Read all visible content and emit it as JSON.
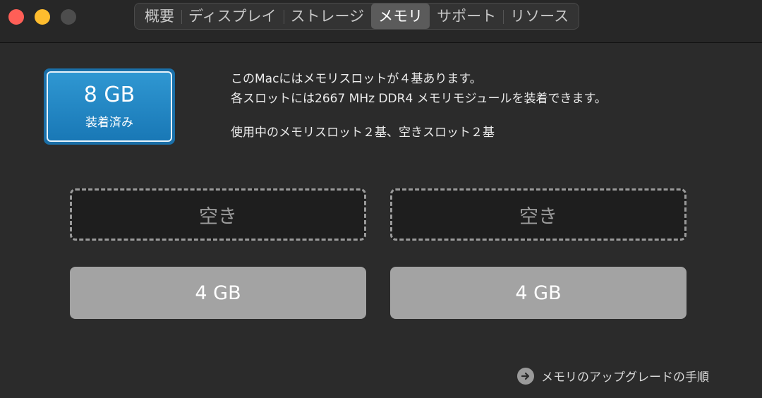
{
  "window": {
    "traffic_lights": [
      "close",
      "minimize",
      "zoom"
    ]
  },
  "tabs": [
    {
      "label": "概要",
      "active": false
    },
    {
      "label": "ディスプレイ",
      "active": false
    },
    {
      "label": "ストレージ",
      "active": false
    },
    {
      "label": "メモリ",
      "active": true
    },
    {
      "label": "サポート",
      "active": false
    },
    {
      "label": "リソース",
      "active": false
    }
  ],
  "installed": {
    "size": "8 GB",
    "label": "装着済み",
    "color": "#1a6fa8"
  },
  "info": {
    "line1": "このMacにはメモリスロットが４基あります。",
    "line2": "各スロットには2667 MHz DDR4 メモリモジュールを装着できます。",
    "line3": "使用中のメモリスロット２基、空きスロット２基"
  },
  "slots": [
    {
      "label": "空き",
      "state": "empty"
    },
    {
      "label": "空き",
      "state": "empty"
    },
    {
      "label": "4 GB",
      "state": "filled"
    },
    {
      "label": "4 GB",
      "state": "filled"
    }
  ],
  "upgrade": {
    "label": "メモリのアップグレードの手順",
    "icon": "arrow-right-circle-icon"
  }
}
